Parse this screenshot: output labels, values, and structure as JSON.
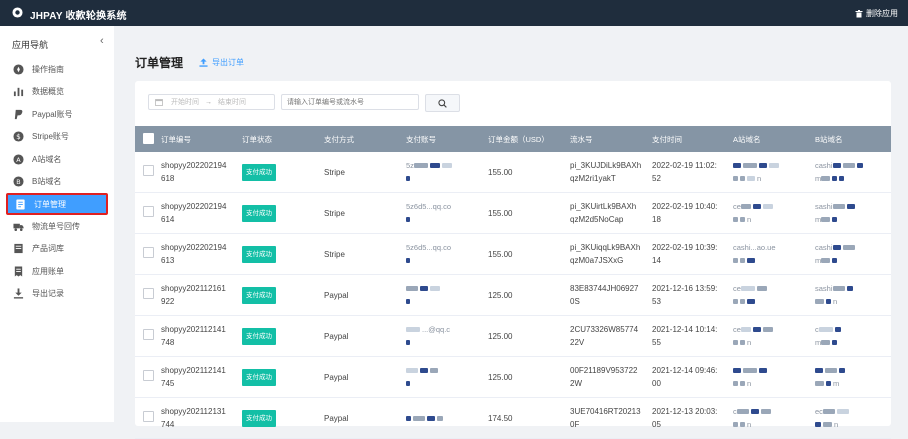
{
  "topbar": {
    "title": "JHPAY 收款轮换系统",
    "right_label": "删除应用"
  },
  "sidebar": {
    "header": "应用导航",
    "collapse": "‹",
    "items": [
      {
        "label": "操作指南",
        "icon": "compass-icon"
      },
      {
        "label": "数据概览",
        "icon": "bar-chart-icon"
      },
      {
        "label": "Paypal账号",
        "icon": "paypal-icon"
      },
      {
        "label": "Stripe账号",
        "icon": "dollar-icon"
      },
      {
        "label": "A站域名",
        "icon": "a-circle-icon"
      },
      {
        "label": "B站域名",
        "icon": "b-circle-icon"
      },
      {
        "label": "订单管理",
        "icon": "document-icon",
        "active": true
      },
      {
        "label": "物流单号回传",
        "icon": "truck-icon"
      },
      {
        "label": "产品词库",
        "icon": "book-icon"
      },
      {
        "label": "应用账单",
        "icon": "bill-icon"
      },
      {
        "label": "导出记录",
        "icon": "download-icon"
      }
    ]
  },
  "page": {
    "title": "订单管理",
    "export_label": "导出订单"
  },
  "filters": {
    "date_start": "开始时间",
    "date_sep": "→",
    "date_end": "结束时间",
    "search_placeholder": "请输入订单编号或流水号"
  },
  "table": {
    "headers": [
      "订单编号",
      "订单状态",
      "支付方式",
      "支付账号",
      "订单金额（USD）",
      "流水号",
      "支付时间",
      "A站域名",
      "B站域名"
    ],
    "rows": [
      {
        "order": [
          "shopyy202202194",
          "618"
        ],
        "status": "支付成功",
        "method": "Stripe",
        "account": "5z",
        "amount": "155.00",
        "serial": [
          "pi_3KUJDiLk9BAXh",
          "qzM2ri1yakT"
        ],
        "time": [
          "2022-02-19 11:02:",
          "52"
        ],
        "a": [
          "",
          "n"
        ],
        "b": [
          "cashi",
          "m"
        ]
      },
      {
        "order": [
          "shopyy202202194",
          "614"
        ],
        "status": "支付成功",
        "method": "Stripe",
        "account": "5z6d5...qq.co",
        "amount": "155.00",
        "serial": [
          "pi_3KUirtLk9BAXh",
          "qzM2d5NoCap"
        ],
        "time": [
          "2022-02-19 10:40:",
          "18"
        ],
        "a": [
          "ce",
          "n"
        ],
        "b": [
          "sashi",
          "m"
        ]
      },
      {
        "order": [
          "shopyy202202194",
          "613"
        ],
        "status": "支付成功",
        "method": "Stripe",
        "account": "5z6d5...qq.co",
        "amount": "155.00",
        "serial": [
          "pi_3KUiqqLk9BAXh",
          "qzM0a7JSXxG"
        ],
        "time": [
          "2022-02-19 10:39:",
          "14"
        ],
        "a": [
          "cashi...ao.ue",
          ""
        ],
        "b": [
          "cashi",
          "m"
        ]
      },
      {
        "order": [
          "shopyy202112161",
          "922"
        ],
        "status": "支付成功",
        "method": "Paypal",
        "account": "",
        "amount": "125.00",
        "serial": [
          "83E83744JH06927",
          "0S"
        ],
        "time": [
          "2021-12-16 13:59:",
          "53"
        ],
        "a": [
          "ce",
          ""
        ],
        "b": [
          "sashi",
          "n"
        ]
      },
      {
        "order": [
          "shopyy202112141",
          "748"
        ],
        "status": "支付成功",
        "method": "Paypal",
        "account": "...@qq.c",
        "amount": "125.00",
        "serial": [
          "2CU73326W85774",
          "22V"
        ],
        "time": [
          "2021-12-14 10:14:",
          "55"
        ],
        "a": [
          "ce",
          "n"
        ],
        "b": [
          "c",
          "m"
        ]
      },
      {
        "order": [
          "shopyy202112141",
          "745"
        ],
        "status": "支付成功",
        "method": "Paypal",
        "account": "",
        "amount": "125.00",
        "serial": [
          "00F21189V953722",
          "2W"
        ],
        "time": [
          "2021-12-14 09:46:",
          "00"
        ],
        "a": [
          "",
          "n"
        ],
        "b": [
          "",
          "m"
        ]
      },
      {
        "order": [
          "shopyy202112131",
          "744"
        ],
        "status": "支付成功",
        "method": "Paypal",
        "account": "",
        "amount": "174.50",
        "serial": [
          "3UE70416RT20213",
          "0F"
        ],
        "time": [
          "2021-12-13 20:03:",
          "05"
        ],
        "a": [
          "c",
          "n"
        ],
        "b": [
          "ec",
          "n"
        ]
      }
    ]
  }
}
